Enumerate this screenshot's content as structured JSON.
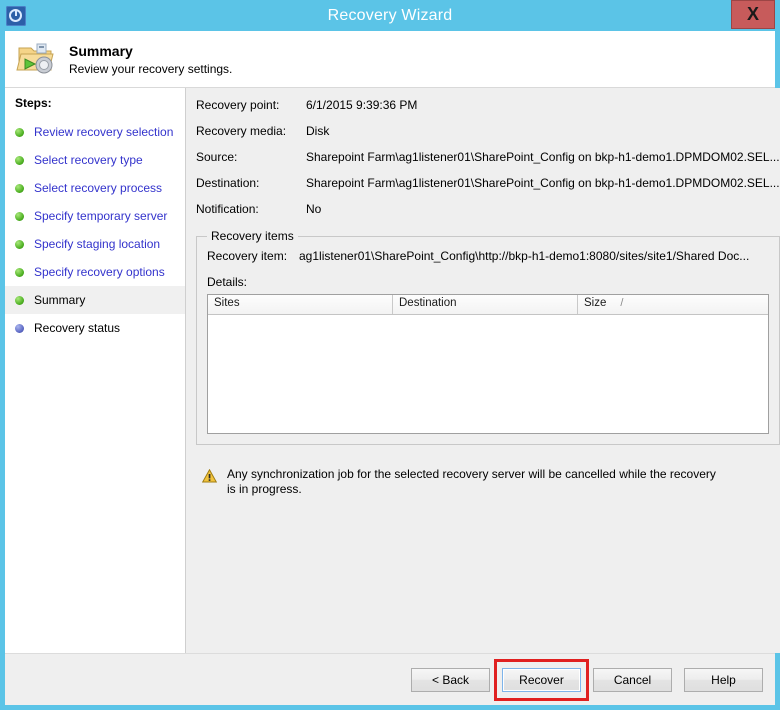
{
  "window": {
    "title": "Recovery Wizard",
    "app_icon": "clock-history-icon",
    "close_label": "X",
    "title_bar_color": "#5bc4e7",
    "close_button_color": "#c75b5b"
  },
  "header": {
    "icon": "folder-recovery-icon",
    "title": "Summary",
    "subtitle": "Review your recovery settings."
  },
  "sidebar": {
    "title": "Steps:",
    "items": [
      {
        "label": "Review recovery selection",
        "state": "done"
      },
      {
        "label": "Select recovery type",
        "state": "done"
      },
      {
        "label": "Select recovery process",
        "state": "done"
      },
      {
        "label": "Specify temporary server",
        "state": "done"
      },
      {
        "label": "Specify staging location",
        "state": "done"
      },
      {
        "label": "Specify recovery options",
        "state": "done"
      },
      {
        "label": "Summary",
        "state": "current"
      },
      {
        "label": "Recovery status",
        "state": "pending"
      }
    ]
  },
  "summary": {
    "rows": [
      {
        "label": "Recovery point:",
        "value": "6/1/2015 9:39:36 PM"
      },
      {
        "label": "Recovery media:",
        "value": "Disk"
      },
      {
        "label": "Source:",
        "value": "Sharepoint Farm\\ag1listener01\\SharePoint_Config on bkp-h1-demo1.DPMDOM02.SEL..."
      },
      {
        "label": "Destination:",
        "value": "Sharepoint Farm\\ag1listener01\\SharePoint_Config on bkp-h1-demo1.DPMDOM02.SEL..."
      },
      {
        "label": "Notification:",
        "value": "No"
      }
    ]
  },
  "recovery_items": {
    "group_title": "Recovery items",
    "item_label": "Recovery item:",
    "item_value": "ag1listener01\\SharePoint_Config\\http://bkp-h1-demo1:8080/sites/site1/Shared Doc...",
    "details_label": "Details:",
    "table": {
      "columns": [
        "Sites",
        "Destination",
        "Size"
      ],
      "size_separator": "/",
      "rows": []
    }
  },
  "warning": {
    "icon": "warning-triangle-icon",
    "text": "Any synchronization job for the selected recovery server will be cancelled while the recovery is in progress."
  },
  "footer": {
    "buttons": [
      {
        "label": "< Back",
        "name": "back-button",
        "default": false,
        "highlighted": false
      },
      {
        "label": "Recover",
        "name": "recover-button",
        "default": true,
        "highlighted": true
      },
      {
        "label": "Cancel",
        "name": "cancel-button",
        "default": false,
        "highlighted": false
      },
      {
        "label": "Help",
        "name": "help-button",
        "default": false,
        "highlighted": false
      }
    ],
    "highlight_color": "#e02020"
  }
}
